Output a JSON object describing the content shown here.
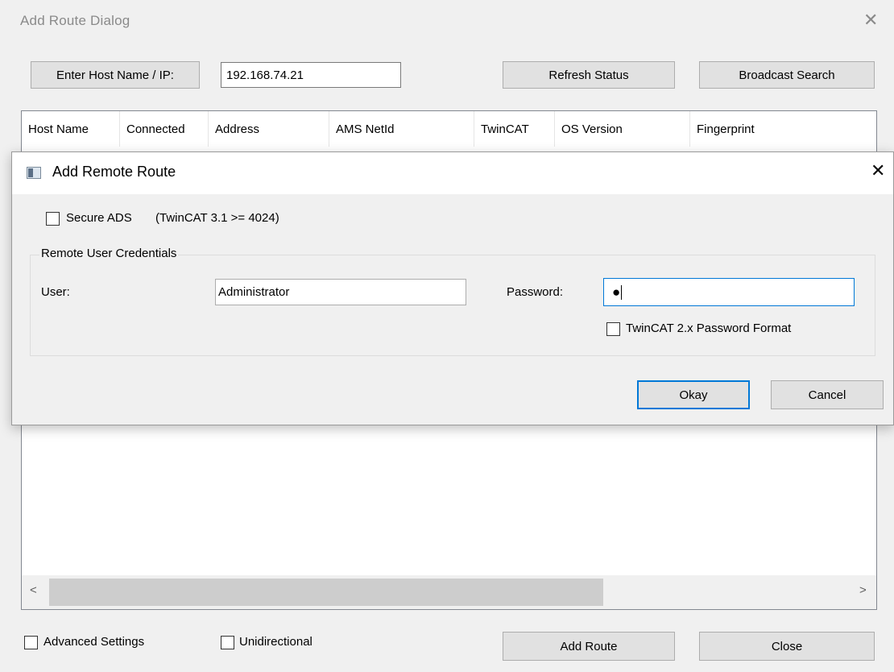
{
  "dialog": {
    "title": "Add Route Dialog",
    "close_glyph": "✕",
    "host_label_button": "Enter Host Name / IP:",
    "host_value": "192.168.74.21",
    "refresh_button": "Refresh Status",
    "broadcast_button": "Broadcast Search",
    "columns": [
      "Host Name",
      "Connected",
      "Address",
      "AMS NetId",
      "TwinCAT",
      "OS Version",
      "Fingerprint"
    ],
    "scroll_left": "<",
    "scroll_right": ">",
    "advanced_settings": {
      "label": "Advanced Settings",
      "checked": false
    },
    "unidirectional": {
      "label": "Unidirectional",
      "checked": false
    },
    "add_route_button": "Add Route",
    "close_button": "Close"
  },
  "remote_route": {
    "title": "Add Remote Route",
    "app_icon": "window-icon",
    "close_glyph": "✕",
    "secure_ads": {
      "label": "Secure ADS",
      "checked": false
    },
    "secure_ads_note": "(TwinCAT 3.1 >= 4024)",
    "credentials_group": "Remote User Credentials",
    "user_label": "User:",
    "user_value": "Administrator",
    "password_label": "Password:",
    "password_value": "●",
    "twincat2_format": {
      "label": "TwinCAT 2.x Password Format",
      "checked": false
    },
    "okay_button": "Okay",
    "cancel_button": "Cancel"
  },
  "colors": {
    "accent": "#0078d7",
    "window_bg": "#f0f0f0"
  }
}
